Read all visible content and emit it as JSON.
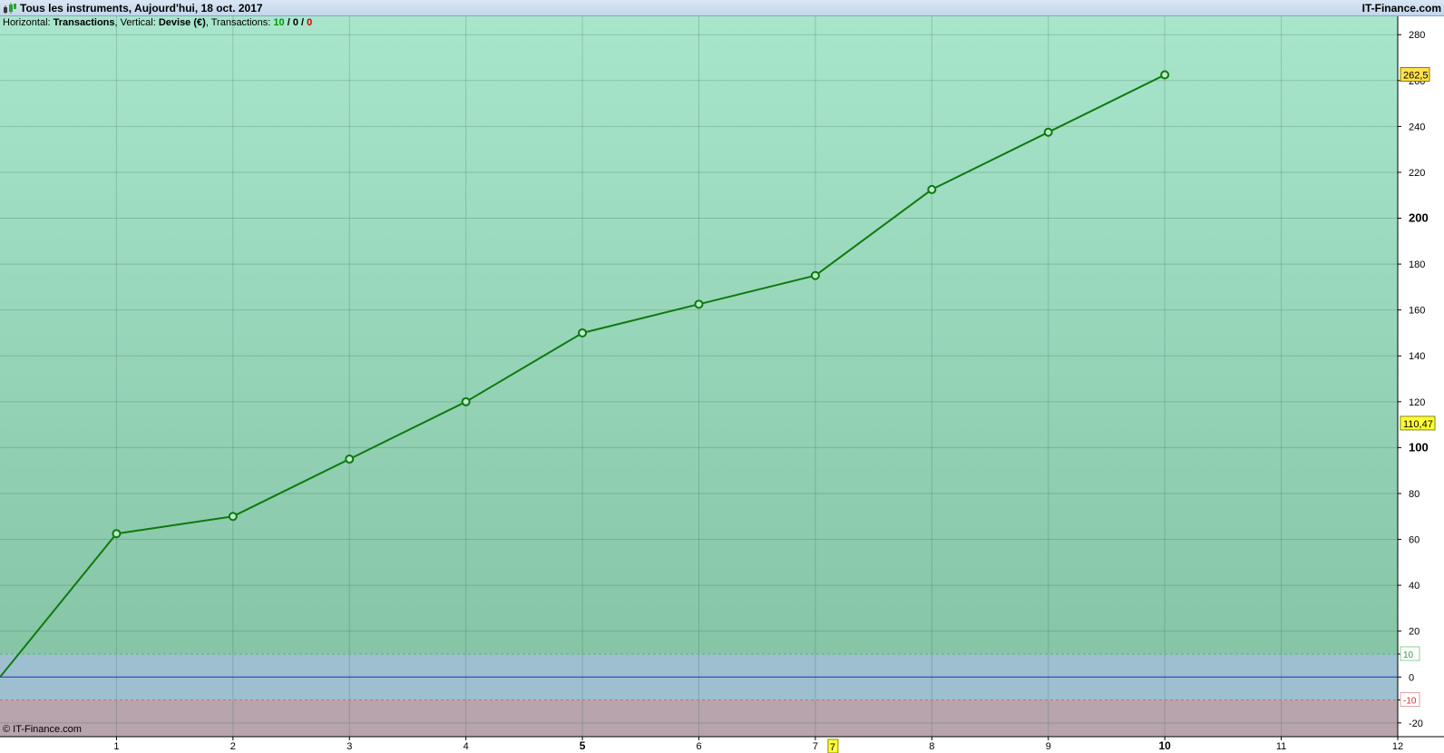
{
  "header": {
    "title": "Tous les instruments, Aujourd'hui, 18 oct. 2017",
    "brand": "IT-Finance.com",
    "subtitle": {
      "horizontal_label": "Horizontal:",
      "horizontal_value": "Transactions",
      "vertical_label": "Vertical:",
      "vertical_value": "Devise (€)",
      "transactions_label": "Transactions:",
      "transactions_green": "10",
      "transactions_black": "0",
      "transactions_red": "0",
      "separator": "/"
    }
  },
  "footer": {
    "copyright": "© IT-Finance.com"
  },
  "colors": {
    "line": "#0d7a0d",
    "zero_line": "#1e2ed2",
    "upper_band_top": "#a8e6cc",
    "upper_band_bottom": "#86c5a6",
    "neutral_band": "#9dbfd0",
    "lower_band": "#b8a4ac",
    "marker_current": "#ffff33",
    "marker_last": "#ffe14d"
  },
  "chart_data": {
    "type": "line",
    "title": "",
    "xlabel": "",
    "ylabel": "",
    "x": [
      0,
      1,
      2,
      3,
      4,
      5,
      6,
      7,
      8,
      9,
      10
    ],
    "series": [
      {
        "values": [
          0,
          62.5,
          70,
          95,
          120,
          150,
          162.5,
          175,
          212.5,
          237.5,
          262.5
        ]
      }
    ],
    "xlim": [
      0,
      12
    ],
    "ylim": [
      -26,
      288
    ],
    "x_ticks": [
      "1",
      "2",
      "3",
      "4",
      "5",
      "6",
      "7",
      "8",
      "9",
      "10",
      "11",
      "12"
    ],
    "x_ticks_bold": [
      "5",
      "10"
    ],
    "y_ticks": [
      "-20",
      "-10",
      "0",
      "10",
      "20",
      "40",
      "60",
      "80",
      "100",
      "120",
      "140",
      "160",
      "180",
      "200",
      "220",
      "240",
      "260",
      "280"
    ],
    "y_ticks_bold": [
      "100",
      "200"
    ],
    "y_tick_values": [
      -20,
      -10,
      0,
      10,
      20,
      40,
      60,
      80,
      100,
      120,
      140,
      160,
      180,
      200,
      220,
      240,
      260,
      280
    ],
    "threshold_upper": 10,
    "threshold_lower": -10,
    "upper_threshold_label": "10",
    "lower_threshold_label": "-10",
    "last_value": 262.5,
    "last_value_label": "262,5",
    "current_value": 110.47,
    "current_value_label": "110,47",
    "x_marker": 7,
    "x_marker_label": "7",
    "grid": true
  }
}
